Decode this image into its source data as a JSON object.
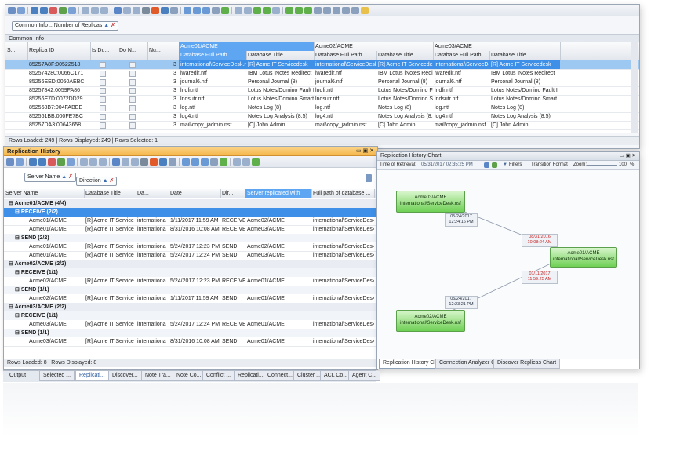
{
  "top": {
    "group_chip": "Common Info :: Number of Replicas",
    "section_title": "Common Info",
    "headers": [
      "S...",
      "Replica ID",
      "Is Du...",
      "Do N...",
      "Nu..."
    ],
    "server_group_headers": [
      "Acme01/ACME",
      "Acme02/ACME",
      "Acme03/ACME"
    ],
    "sub_headers": [
      "Database Full Path",
      "Database Title",
      "Database Full Path",
      "Database Title",
      "Database Full Path",
      "Database Title"
    ],
    "rows": [
      {
        "id": "85257A8F:00522518",
        "n": "3",
        "p1": "international\\ServiceDesk.nsf",
        "t1": "[R] Acme IT Servicedesk",
        "p2": "international\\ServiceDesk.nsf",
        "t2": "[R] Acme IT Servicedesk",
        "p3": "international\\ServiceDesk.nsf",
        "t3": "[R] Acme IT Servicedesk"
      },
      {
        "id": "852574280:0066C171",
        "n": "3",
        "p1": "iwaredir.ntf",
        "t1": "IBM Lotus iNotes Redirect",
        "p2": "iwaredir.ntf",
        "t2": "IBM Lotus iNotes Redirect",
        "p3": "iwaredir.ntf",
        "t3": "IBM Lotus iNotes Redirect"
      },
      {
        "id": "85256EED:0050AEBC",
        "n": "3",
        "p1": "journal6.ntf",
        "t1": "Personal Journal (8)",
        "p2": "journal6.ntf",
        "t2": "Personal Journal (8)",
        "p3": "journal6.ntf",
        "t3": "Personal Journal (8)"
      },
      {
        "id": "85257842:0059FA86",
        "n": "3",
        "p1": "lndfr.ntf",
        "t1": "Lotus Notes/Domino Fault I",
        "p2": "lndfr.ntf",
        "t2": "Lotus Notes/Domino Fault I",
        "p3": "lndfr.ntf",
        "t3": "Lotus Notes/Domino Fault I"
      },
      {
        "id": "85256E7D:0072DD29",
        "n": "3",
        "p1": "lndsutr.ntf",
        "t1": "Lotus Notes/Domino Smart",
        "p2": "lndsutr.ntf",
        "t2": "Lotus Notes/Domino Smart",
        "p3": "lndsutr.ntf",
        "t3": "Lotus Notes/Domino Smart"
      },
      {
        "id": "852568B7:004FABEE",
        "n": "3",
        "p1": "log.ntf",
        "t1": "Notes Log (8)",
        "p2": "log.ntf",
        "t2": "Notes Log (8)",
        "p3": "log.ntf",
        "t3": "Notes Log (8)"
      },
      {
        "id": "852561BB:000FE7BC",
        "n": "3",
        "p1": "log4.ntf",
        "t1": "Notes Log Analysis (8.5)",
        "p2": "log4.ntf",
        "t2": "Notes Log Analysis (8.5)",
        "p3": "log4.ntf",
        "t3": "Notes Log Analysis (8.5)"
      },
      {
        "id": "85257DA3:00643658",
        "n": "3",
        "p1": "mail\\copy_jadmin.nsf",
        "t1": "[C] John Admin",
        "p2": "mail\\copy_jadmin.nsf",
        "t2": "[C] John Admin",
        "p3": "mail\\copy_jadmin.nsf",
        "t3": "[C] John Admin"
      }
    ],
    "status": "Rows Loaded: 249  |  Rows Displayed: 249  |  Rows Selected: 1"
  },
  "history": {
    "title": "Replication History",
    "chips": [
      "Server Name",
      "Direction"
    ],
    "headers": [
      "Server Name",
      "Database Title",
      "Da...",
      "Date",
      "Dir...",
      "Server replicated with",
      "Full path of database ..."
    ],
    "lines": [
      {
        "kind": "g1",
        "text": "Acme01/ACME (4/4)"
      },
      {
        "kind": "g2",
        "text": "RECEIVE (2/2)",
        "selected": true
      },
      {
        "kind": "r",
        "c": [
          "Acme01/ACME",
          "[R] Acme IT Service",
          "internationa",
          "1/11/2017 11:59 AM",
          "RECEIVE",
          "Acme02/ACME",
          "international\\ServiceDesk.n"
        ]
      },
      {
        "kind": "r",
        "c": [
          "Acme01/ACME",
          "[R] Acme IT Service",
          "internationa",
          "8/31/2016 10:08 AM",
          "RECEIVE",
          "Acme03/ACME",
          "international\\ServiceDesk.n"
        ]
      },
      {
        "kind": "g2",
        "text": "SEND (2/2)"
      },
      {
        "kind": "r",
        "c": [
          "Acme01/ACME",
          "[R] Acme IT Service",
          "internationa",
          "5/24/2017 12:23 PM",
          "SEND",
          "Acme02/ACME",
          "international\\ServiceDesk.n"
        ]
      },
      {
        "kind": "r",
        "c": [
          "Acme01/ACME",
          "[R] Acme IT Service",
          "internationa",
          "5/24/2017 12:24 PM",
          "SEND",
          "Acme03/ACME",
          "international\\ServiceDesk.n"
        ]
      },
      {
        "kind": "g1",
        "text": "Acme02/ACME (2/2)"
      },
      {
        "kind": "g2",
        "text": "RECEIVE (1/1)"
      },
      {
        "kind": "r",
        "c": [
          "Acme02/ACME",
          "[R] Acme IT Service",
          "internationa",
          "5/24/2017 12:23 PM",
          "RECEIVE",
          "Acme01/ACME",
          "international\\ServiceDesk.n"
        ]
      },
      {
        "kind": "g2",
        "text": "SEND (1/1)"
      },
      {
        "kind": "r",
        "c": [
          "Acme02/ACME",
          "[R] Acme IT Service",
          "internationa",
          "1/11/2017 11:59 AM",
          "SEND",
          "Acme01/ACME",
          "international\\ServiceDesk.n"
        ]
      },
      {
        "kind": "g1",
        "text": "Acme03/ACME (2/2)"
      },
      {
        "kind": "g2",
        "text": "RECEIVE (1/1)"
      },
      {
        "kind": "r",
        "c": [
          "Acme03/ACME",
          "[R] Acme IT Service",
          "internationa",
          "5/24/2017 12:24 PM",
          "RECEIVE",
          "Acme01/ACME",
          "international\\ServiceDesk.n"
        ]
      },
      {
        "kind": "g2",
        "text": "SEND (1/1)"
      },
      {
        "kind": "r",
        "c": [
          "Acme03/ACME",
          "[R] Acme IT Service",
          "internationa",
          "8/31/2016 10:08 AM",
          "SEND",
          "Acme01/ACME",
          "international\\ServiceDesk.n"
        ]
      }
    ],
    "status": "Rows Loaded: 8  |  Rows Displayed: 8"
  },
  "chart": {
    "title": "Replication History Chart",
    "time_label": "Time of Retrieval:",
    "time_value": "05/31/2017 02:35:25 PM",
    "filters": "Filters",
    "transition": "Transition Format",
    "zoom_label": "Zoom:",
    "zoom_value": "100",
    "zoom_unit": "%",
    "nodes": [
      {
        "line1": "Acme03/ACME",
        "line2": "international\\ServiceDesk.nsf"
      },
      {
        "line1": "Acme01/ACME",
        "line2": "international\\ServiceDesk.nsf"
      },
      {
        "line1": "Acme02/ACME",
        "line2": "international\\ServiceDesk.nsf"
      }
    ],
    "edge_labels": [
      {
        "d": "05/24/2017",
        "t": "12:24:16 PM"
      },
      {
        "d": "08/31/2016",
        "t": "10:08:24 AM"
      },
      {
        "d": "01/11/2017",
        "t": "11:59:25 AM"
      },
      {
        "d": "05/24/2017",
        "t": "12:23:21 PM"
      }
    ],
    "tabs": [
      "Replication History Chart",
      "Connection Analyzer Chart",
      "Discover Replicas Chart"
    ]
  },
  "bottom_tabs": [
    "Output",
    "Selected ...",
    "Replicati...",
    "Discover...",
    "Note Tra...",
    "Note Co...",
    "Conflict ...",
    "Replicati...",
    "Connect...",
    "Cluster ...",
    "ACL Co...",
    "Agent C..."
  ],
  "colors": {
    "accent": "#3d8fe8",
    "selection": "#5ea6f2",
    "tab_orange": "#f5b64a",
    "node_green": "#6fd055",
    "late_red": "#c81e1e"
  }
}
